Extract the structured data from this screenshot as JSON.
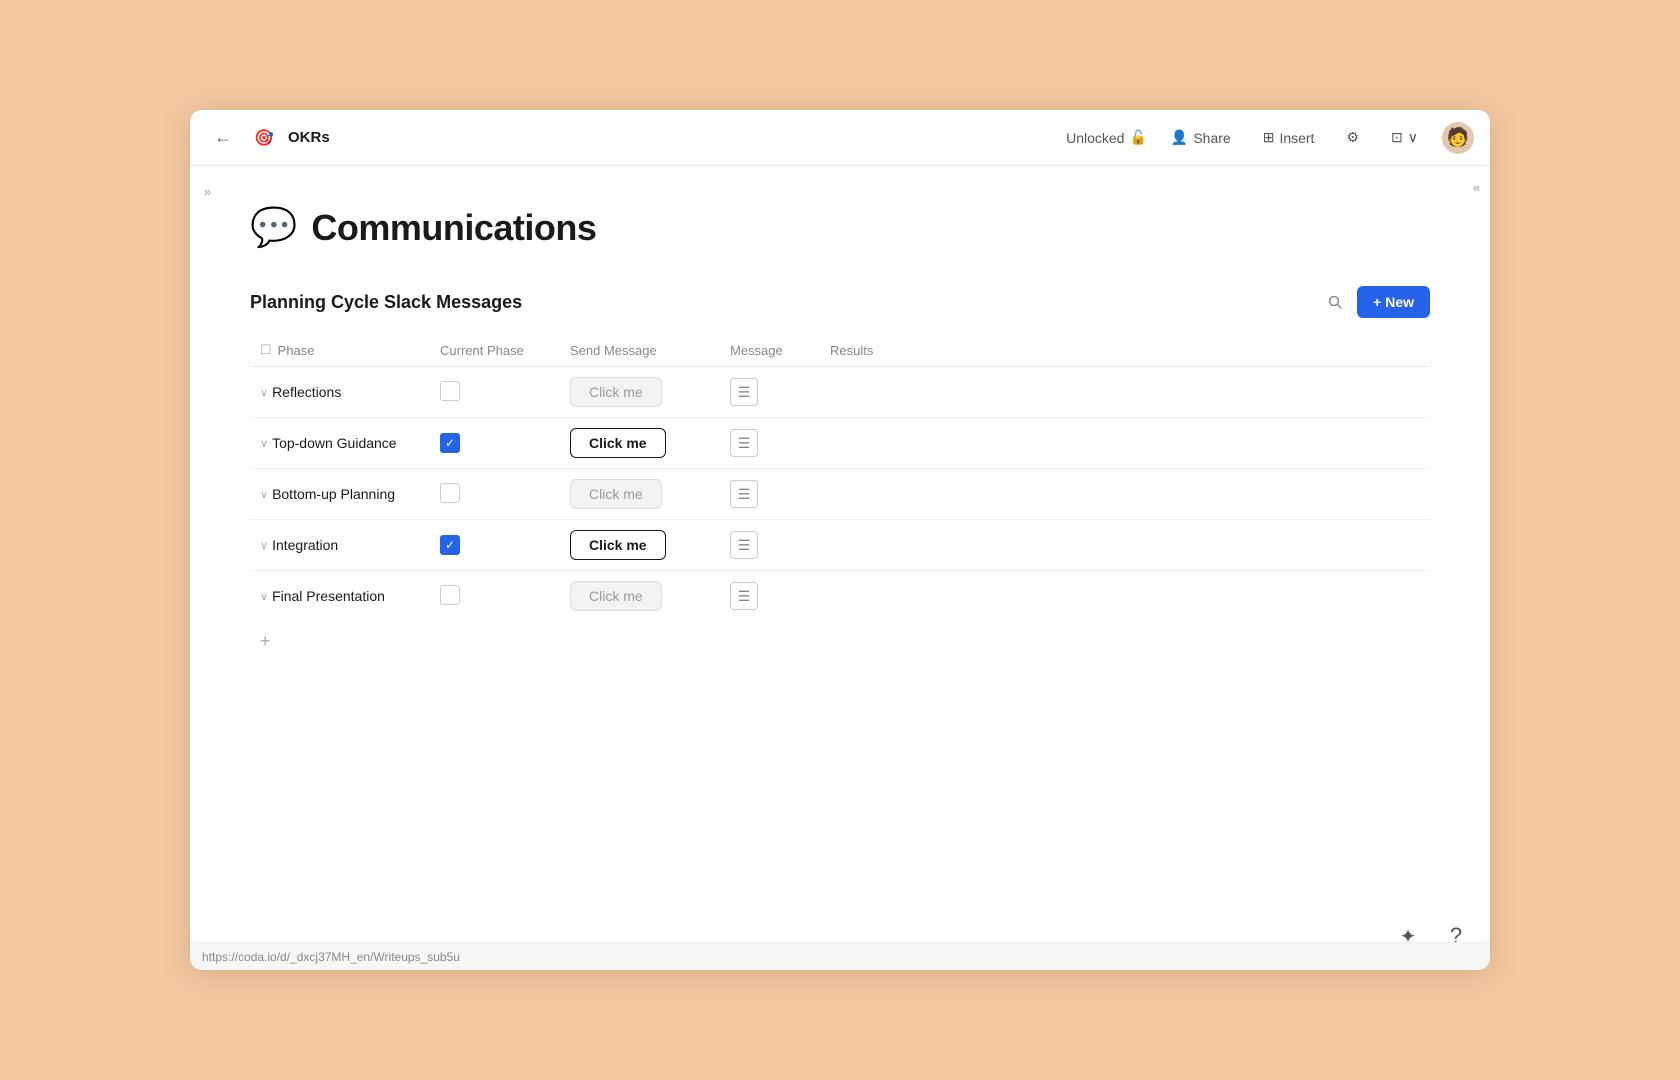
{
  "header": {
    "back_label": "←",
    "doc_icon": "🎯",
    "doc_title": "OKRs",
    "unlocked_label": "Unlocked",
    "share_label": "Share",
    "insert_label": "Insert",
    "settings_icon": "⚙",
    "expand_icon": "⊞",
    "chevron_icon": "∨"
  },
  "sidebar": {
    "expand_icon": "»",
    "collapse_icon": "«"
  },
  "page": {
    "emoji": "💬",
    "title": "Communications"
  },
  "table": {
    "section_title": "Planning Cycle Slack Messages",
    "new_button": "+ New",
    "columns": {
      "phase": "Phase",
      "current_phase": "Current Phase",
      "send_message": "Send Message",
      "message": "Message",
      "results": "Results"
    },
    "rows": [
      {
        "phase": "Reflections",
        "current_phase_checked": false,
        "send_button": "Click me",
        "send_active": false
      },
      {
        "phase": "Top-down Guidance",
        "current_phase_checked": true,
        "send_button": "Click me",
        "send_active": true
      },
      {
        "phase": "Bottom-up Planning",
        "current_phase_checked": false,
        "send_button": "Click me",
        "send_active": false
      },
      {
        "phase": "Integration",
        "current_phase_checked": true,
        "send_button": "Click me",
        "send_active": true
      },
      {
        "phase": "Final Presentation",
        "current_phase_checked": false,
        "send_button": "Click me",
        "send_active": false
      }
    ],
    "add_row_icon": "+",
    "message_icon": "☰"
  },
  "status_bar": {
    "url": "https://coda.io/d/_dxcj37MH_en/Writeups_sub5u"
  },
  "bottom_right": {
    "sparkle_icon": "✦",
    "help_icon": "?"
  }
}
